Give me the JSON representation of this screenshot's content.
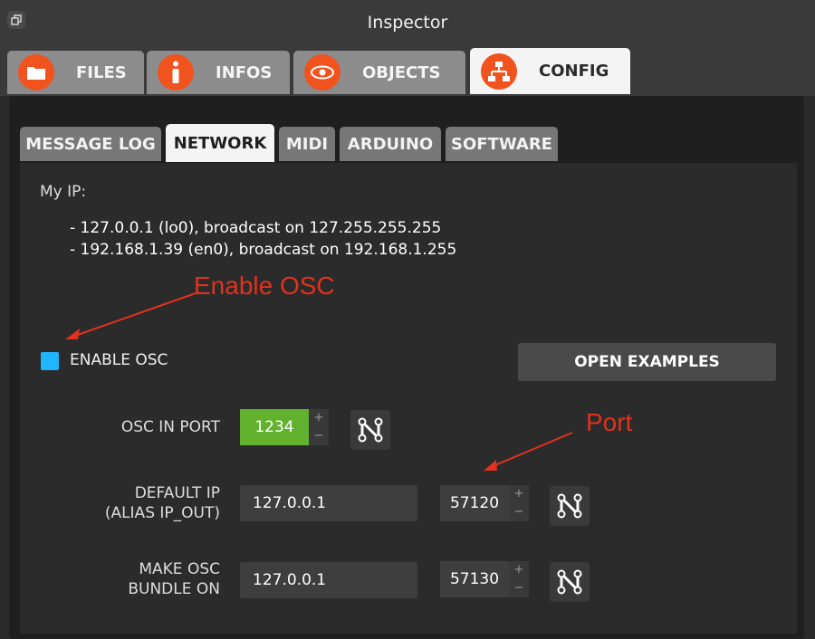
{
  "window": {
    "title": "Inspector"
  },
  "main_tabs": [
    {
      "label": "FILES",
      "icon": "folder-icon"
    },
    {
      "label": "INFOS",
      "icon": "info-icon"
    },
    {
      "label": "OBJECTS",
      "icon": "eye-icon"
    },
    {
      "label": "CONFIG",
      "icon": "network-icon",
      "active": true
    }
  ],
  "sub_tabs": [
    {
      "label": "MESSAGE LOG"
    },
    {
      "label": "NETWORK",
      "active": true
    },
    {
      "label": "MIDI"
    },
    {
      "label": "ARDUINO"
    },
    {
      "label": "SOFTWARE"
    }
  ],
  "network": {
    "my_ip_label": "My IP:",
    "ip_lines": [
      "- 127.0.0.1 (lo0), broadcast on 127.255.255.255",
      "- 192.168.1.39 (en0), broadcast on 192.168.1.255"
    ],
    "enable_osc_label": "ENABLE OSC",
    "enable_osc_checked": true,
    "open_examples_label": "OPEN EXAMPLES",
    "osc_in_port_label": "OSC IN PORT",
    "osc_in_port_value": "1234",
    "default_ip_label_1": "DEFAULT IP",
    "default_ip_label_2": "(ALIAS IP_OUT)",
    "default_ip_value": "127.0.0.1",
    "default_ip_port": "57120",
    "bundle_label_1": "MAKE OSC",
    "bundle_label_2": "BUNDLE ON",
    "bundle_ip_value": "127.0.0.1",
    "bundle_port": "57130",
    "stepper_plus": "+",
    "stepper_minus": "−"
  },
  "annotations": {
    "enable_osc": "Enable OSC",
    "port": "Port"
  },
  "colors": {
    "accent_orange": "#f0531e",
    "checkbox_blue": "#1fb5ff",
    "port_green": "#62b22f",
    "annotation_red": "#e0321e"
  }
}
